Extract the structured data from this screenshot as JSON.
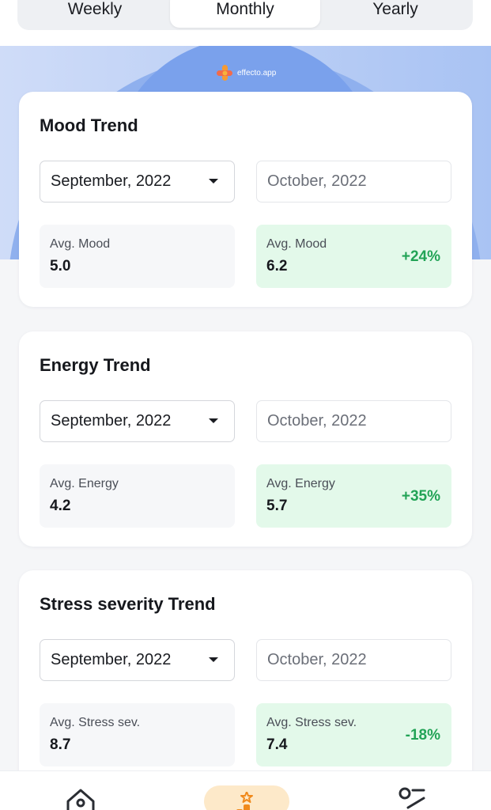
{
  "period_tabs": [
    {
      "label": "Weekly",
      "active": false
    },
    {
      "label": "Monthly",
      "active": true
    },
    {
      "label": "Yearly",
      "active": false
    }
  ],
  "brand": {
    "name": "effecto.app"
  },
  "colors": {
    "accent_green": "#22a356",
    "positive_bg": "#e3f9ea",
    "hero_blue": "#7aa1ec",
    "brand_orange": "#f59a33",
    "nav_active_bg": "#fde9c9"
  },
  "cards": [
    {
      "title": "Mood Trend",
      "compare_from": "September, 2022",
      "compare_to": "October, 2022",
      "left_stat": {
        "label": "Avg. Mood",
        "value": "5.0"
      },
      "right_stat": {
        "label": "Avg. Mood",
        "value": "6.2",
        "change": "+24%"
      }
    },
    {
      "title": "Energy Trend",
      "compare_from": "September, 2022",
      "compare_to": "October, 2022",
      "left_stat": {
        "label": "Avg. Energy",
        "value": "4.2"
      },
      "right_stat": {
        "label": "Avg. Energy",
        "value": "5.7",
        "change": "+35%"
      }
    },
    {
      "title": "Stress severity Trend",
      "compare_from": "September, 2022",
      "compare_to": "October, 2022",
      "left_stat": {
        "label": "Avg. Stress sev.",
        "value": "8.7"
      },
      "right_stat": {
        "label": "Avg. Stress sev.",
        "value": "7.4",
        "change": "-18%"
      }
    }
  ],
  "bottom_nav": [
    {
      "icon": "home-icon",
      "active": false
    },
    {
      "icon": "insights-icon",
      "active": true
    },
    {
      "icon": "routes-icon",
      "active": false
    }
  ]
}
